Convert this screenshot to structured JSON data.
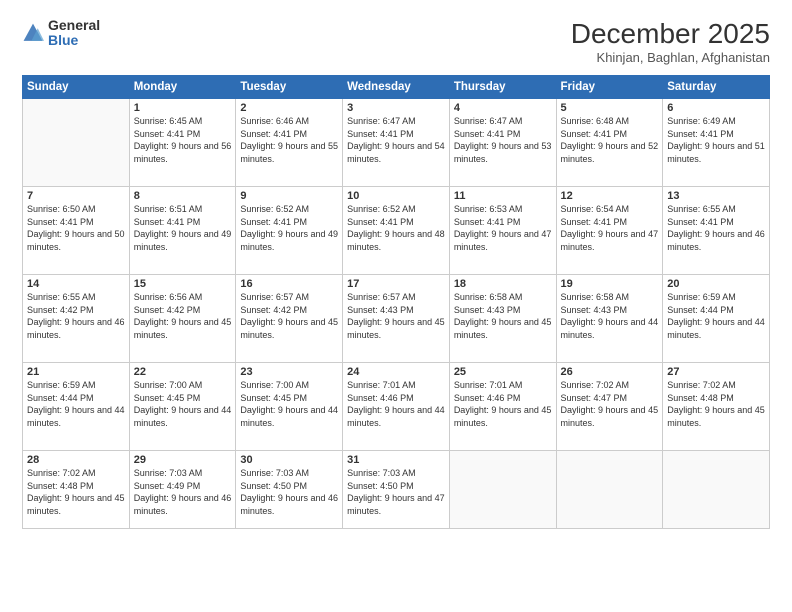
{
  "logo": {
    "general": "General",
    "blue": "Blue"
  },
  "header": {
    "month": "December 2025",
    "location": "Khinjan, Baghlan, Afghanistan"
  },
  "weekdays": [
    "Sunday",
    "Monday",
    "Tuesday",
    "Wednesday",
    "Thursday",
    "Friday",
    "Saturday"
  ],
  "weeks": [
    [
      {
        "day": "",
        "sunrise": "",
        "sunset": "",
        "daylight": ""
      },
      {
        "day": "1",
        "sunrise": "Sunrise: 6:45 AM",
        "sunset": "Sunset: 4:41 PM",
        "daylight": "Daylight: 9 hours and 56 minutes."
      },
      {
        "day": "2",
        "sunrise": "Sunrise: 6:46 AM",
        "sunset": "Sunset: 4:41 PM",
        "daylight": "Daylight: 9 hours and 55 minutes."
      },
      {
        "day": "3",
        "sunrise": "Sunrise: 6:47 AM",
        "sunset": "Sunset: 4:41 PM",
        "daylight": "Daylight: 9 hours and 54 minutes."
      },
      {
        "day": "4",
        "sunrise": "Sunrise: 6:47 AM",
        "sunset": "Sunset: 4:41 PM",
        "daylight": "Daylight: 9 hours and 53 minutes."
      },
      {
        "day": "5",
        "sunrise": "Sunrise: 6:48 AM",
        "sunset": "Sunset: 4:41 PM",
        "daylight": "Daylight: 9 hours and 52 minutes."
      },
      {
        "day": "6",
        "sunrise": "Sunrise: 6:49 AM",
        "sunset": "Sunset: 4:41 PM",
        "daylight": "Daylight: 9 hours and 51 minutes."
      }
    ],
    [
      {
        "day": "7",
        "sunrise": "Sunrise: 6:50 AM",
        "sunset": "Sunset: 4:41 PM",
        "daylight": "Daylight: 9 hours and 50 minutes."
      },
      {
        "day": "8",
        "sunrise": "Sunrise: 6:51 AM",
        "sunset": "Sunset: 4:41 PM",
        "daylight": "Daylight: 9 hours and 49 minutes."
      },
      {
        "day": "9",
        "sunrise": "Sunrise: 6:52 AM",
        "sunset": "Sunset: 4:41 PM",
        "daylight": "Daylight: 9 hours and 49 minutes."
      },
      {
        "day": "10",
        "sunrise": "Sunrise: 6:52 AM",
        "sunset": "Sunset: 4:41 PM",
        "daylight": "Daylight: 9 hours and 48 minutes."
      },
      {
        "day": "11",
        "sunrise": "Sunrise: 6:53 AM",
        "sunset": "Sunset: 4:41 PM",
        "daylight": "Daylight: 9 hours and 47 minutes."
      },
      {
        "day": "12",
        "sunrise": "Sunrise: 6:54 AM",
        "sunset": "Sunset: 4:41 PM",
        "daylight": "Daylight: 9 hours and 47 minutes."
      },
      {
        "day": "13",
        "sunrise": "Sunrise: 6:55 AM",
        "sunset": "Sunset: 4:41 PM",
        "daylight": "Daylight: 9 hours and 46 minutes."
      }
    ],
    [
      {
        "day": "14",
        "sunrise": "Sunrise: 6:55 AM",
        "sunset": "Sunset: 4:42 PM",
        "daylight": "Daylight: 9 hours and 46 minutes."
      },
      {
        "day": "15",
        "sunrise": "Sunrise: 6:56 AM",
        "sunset": "Sunset: 4:42 PM",
        "daylight": "Daylight: 9 hours and 45 minutes."
      },
      {
        "day": "16",
        "sunrise": "Sunrise: 6:57 AM",
        "sunset": "Sunset: 4:42 PM",
        "daylight": "Daylight: 9 hours and 45 minutes."
      },
      {
        "day": "17",
        "sunrise": "Sunrise: 6:57 AM",
        "sunset": "Sunset: 4:43 PM",
        "daylight": "Daylight: 9 hours and 45 minutes."
      },
      {
        "day": "18",
        "sunrise": "Sunrise: 6:58 AM",
        "sunset": "Sunset: 4:43 PM",
        "daylight": "Daylight: 9 hours and 45 minutes."
      },
      {
        "day": "19",
        "sunrise": "Sunrise: 6:58 AM",
        "sunset": "Sunset: 4:43 PM",
        "daylight": "Daylight: 9 hours and 44 minutes."
      },
      {
        "day": "20",
        "sunrise": "Sunrise: 6:59 AM",
        "sunset": "Sunset: 4:44 PM",
        "daylight": "Daylight: 9 hours and 44 minutes."
      }
    ],
    [
      {
        "day": "21",
        "sunrise": "Sunrise: 6:59 AM",
        "sunset": "Sunset: 4:44 PM",
        "daylight": "Daylight: 9 hours and 44 minutes."
      },
      {
        "day": "22",
        "sunrise": "Sunrise: 7:00 AM",
        "sunset": "Sunset: 4:45 PM",
        "daylight": "Daylight: 9 hours and 44 minutes."
      },
      {
        "day": "23",
        "sunrise": "Sunrise: 7:00 AM",
        "sunset": "Sunset: 4:45 PM",
        "daylight": "Daylight: 9 hours and 44 minutes."
      },
      {
        "day": "24",
        "sunrise": "Sunrise: 7:01 AM",
        "sunset": "Sunset: 4:46 PM",
        "daylight": "Daylight: 9 hours and 44 minutes."
      },
      {
        "day": "25",
        "sunrise": "Sunrise: 7:01 AM",
        "sunset": "Sunset: 4:46 PM",
        "daylight": "Daylight: 9 hours and 45 minutes."
      },
      {
        "day": "26",
        "sunrise": "Sunrise: 7:02 AM",
        "sunset": "Sunset: 4:47 PM",
        "daylight": "Daylight: 9 hours and 45 minutes."
      },
      {
        "day": "27",
        "sunrise": "Sunrise: 7:02 AM",
        "sunset": "Sunset: 4:48 PM",
        "daylight": "Daylight: 9 hours and 45 minutes."
      }
    ],
    [
      {
        "day": "28",
        "sunrise": "Sunrise: 7:02 AM",
        "sunset": "Sunset: 4:48 PM",
        "daylight": "Daylight: 9 hours and 45 minutes."
      },
      {
        "day": "29",
        "sunrise": "Sunrise: 7:03 AM",
        "sunset": "Sunset: 4:49 PM",
        "daylight": "Daylight: 9 hours and 46 minutes."
      },
      {
        "day": "30",
        "sunrise": "Sunrise: 7:03 AM",
        "sunset": "Sunset: 4:50 PM",
        "daylight": "Daylight: 9 hours and 46 minutes."
      },
      {
        "day": "31",
        "sunrise": "Sunrise: 7:03 AM",
        "sunset": "Sunset: 4:50 PM",
        "daylight": "Daylight: 9 hours and 47 minutes."
      },
      {
        "day": "",
        "sunrise": "",
        "sunset": "",
        "daylight": ""
      },
      {
        "day": "",
        "sunrise": "",
        "sunset": "",
        "daylight": ""
      },
      {
        "day": "",
        "sunrise": "",
        "sunset": "",
        "daylight": ""
      }
    ]
  ]
}
